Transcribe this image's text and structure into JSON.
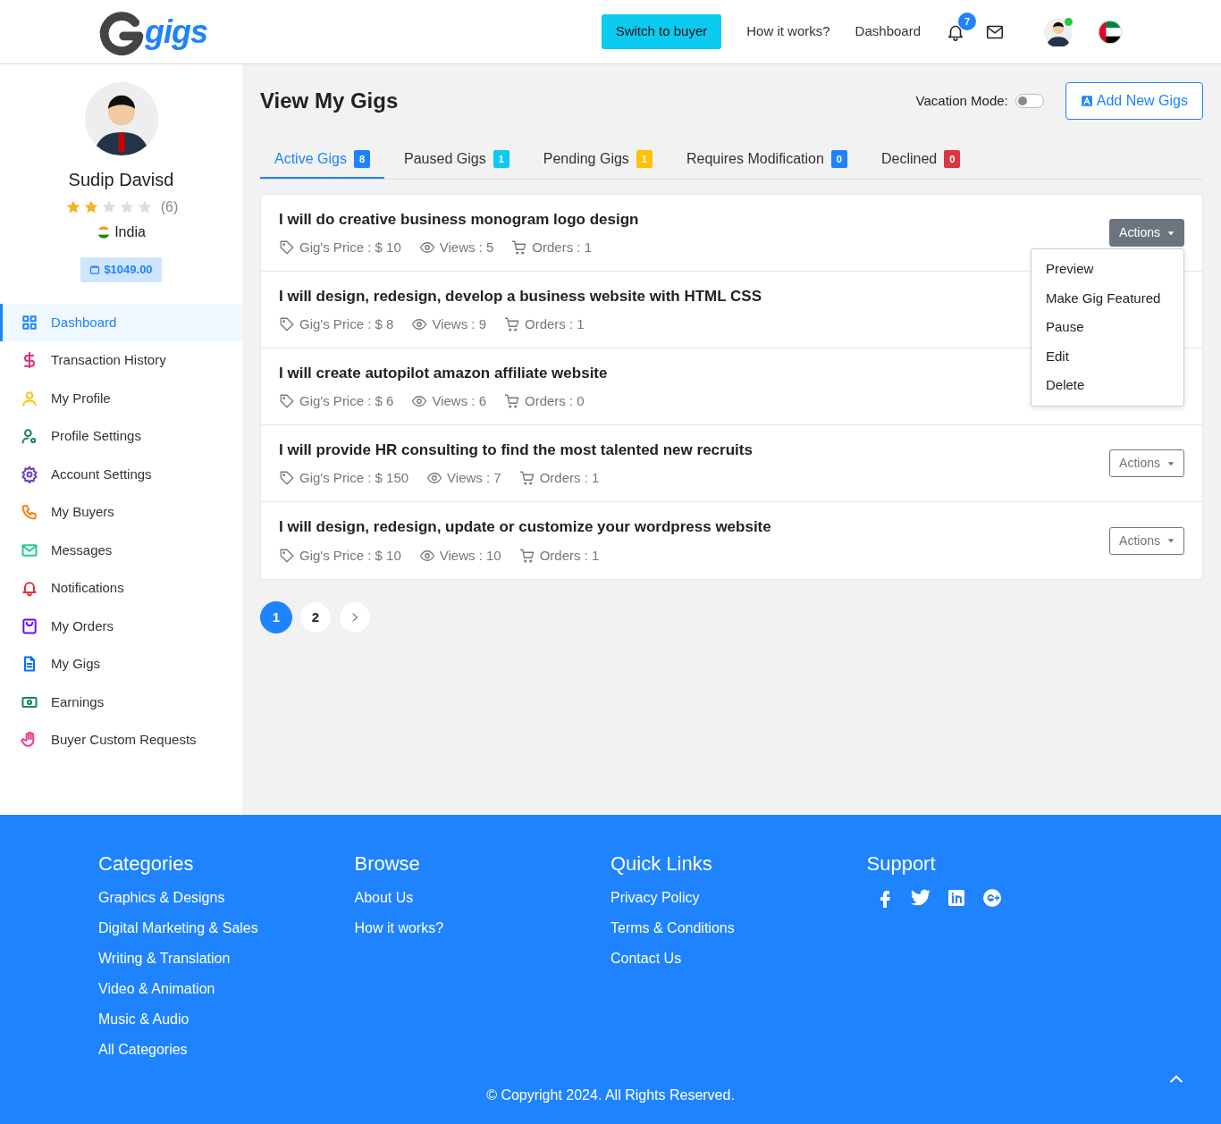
{
  "header": {
    "logo_text": "gigs",
    "switch_button": "Switch to buyer",
    "nav_links": [
      "How it works?",
      "Dashboard"
    ],
    "notification_count": "7",
    "user_online": true
  },
  "profile": {
    "name": "Sudip Davisd",
    "stars": 2,
    "reviews": "(6)",
    "country": "India",
    "balance": "$1049.00"
  },
  "sidebar": {
    "items": [
      {
        "label": "Dashboard",
        "color": "#1e83fd",
        "selected": true
      },
      {
        "label": "Transaction History",
        "color": "#d63384",
        "selected": false
      },
      {
        "label": "My Profile",
        "color": "#ffc107",
        "selected": false
      },
      {
        "label": "Profile Settings",
        "color": "#198754",
        "selected": false
      },
      {
        "label": "Account Settings",
        "color": "#6f42c1",
        "selected": false
      },
      {
        "label": "My Buyers",
        "color": "#fd7e14",
        "selected": false
      },
      {
        "label": "Messages",
        "color": "#20c997",
        "selected": false
      },
      {
        "label": "Notifications",
        "color": "#dc3545",
        "selected": false
      },
      {
        "label": "My Orders",
        "color": "#6610f2",
        "selected": false
      },
      {
        "label": "My Gigs",
        "color": "#0d6efd",
        "selected": false
      },
      {
        "label": "Earnings",
        "color": "#198754",
        "selected": false
      },
      {
        "label": "Buyer Custom Requests",
        "color": "#e83e8c",
        "selected": false
      }
    ]
  },
  "page": {
    "title": "View My Gigs",
    "vacation_label": "Vacation Mode:",
    "vacation_on": false,
    "add_button": "Add New Gigs"
  },
  "tabs": [
    {
      "label": "Active Gigs",
      "count": "8",
      "color": "#1e83fd",
      "selected": true
    },
    {
      "label": "Paused Gigs",
      "count": "1",
      "color": "#0dcaf0",
      "selected": false
    },
    {
      "label": "Pending Gigs",
      "count": "1",
      "color": "#ffc107",
      "selected": false
    },
    {
      "label": "Requires Modification",
      "count": "0",
      "color": "#1e83fd",
      "selected": false
    },
    {
      "label": "Declined",
      "count": "0",
      "color": "#dc3545",
      "selected": false
    }
  ],
  "gigs": [
    {
      "title": "I will do creative business monogram logo design",
      "price": "Gig's Price : $ 10",
      "views": "Views : 5",
      "orders": "Orders : 1",
      "actions": "Actions",
      "open": true
    },
    {
      "title": "I will design, redesign, develop a business website with HTML CSS",
      "price": "Gig's Price : $ 8",
      "views": "Views : 9",
      "orders": "Orders : 1"
    },
    {
      "title": "I will create autopilot amazon affiliate website",
      "price": "Gig's Price : $ 6",
      "views": "Views : 6",
      "orders": "Orders : 0"
    },
    {
      "title": "I will provide HR consulting to find the most talented new recruits",
      "price": "Gig's Price : $ 150",
      "views": "Views : 7",
      "orders": "Orders : 1",
      "actions": "Actions",
      "open": false
    },
    {
      "title": "I will design, redesign, update or customize your wordpress website",
      "price": "Gig's Price : $ 10",
      "views": "Views : 10",
      "orders": "Orders : 1",
      "actions": "Actions",
      "open": false
    }
  ],
  "actions_menu": [
    "Preview",
    "Make Gig Featured",
    "Pause",
    "Edit",
    "Delete"
  ],
  "pagination": [
    {
      "label": "1",
      "selected": true
    },
    {
      "label": "2",
      "selected": false
    }
  ],
  "footer": {
    "columns": [
      {
        "title": "Categories",
        "links": [
          "Graphics & Designs",
          "Digital Marketing & Sales",
          "Writing & Translation",
          "Video & Animation",
          "Music & Audio",
          "All Categories"
        ]
      },
      {
        "title": "Browse",
        "links": [
          "About Us",
          "How it works?"
        ]
      },
      {
        "title": "Quick Links",
        "links": [
          "Privacy Policy",
          "Terms & Conditions",
          "Contact Us"
        ]
      },
      {
        "title": "Support"
      }
    ],
    "copyright": "© Copyright 2024. All Rights Reserved."
  }
}
